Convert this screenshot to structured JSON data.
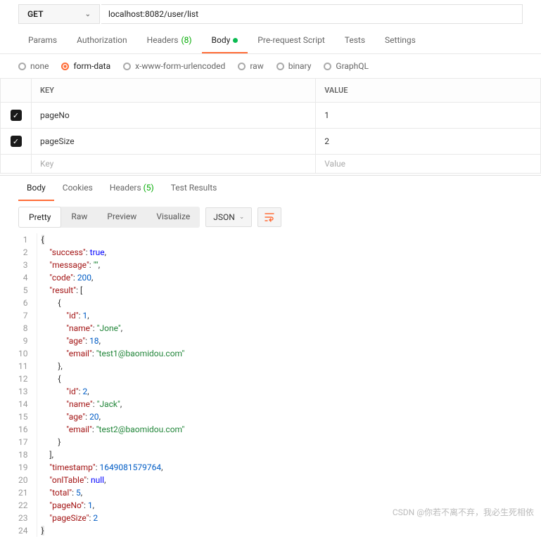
{
  "request": {
    "method": "GET",
    "url": "localhost:8082/user/list"
  },
  "tabs": {
    "params": "Params",
    "authorization": "Authorization",
    "headers": "Headers",
    "headers_count": "(8)",
    "body": "Body",
    "prerequest": "Pre-request Script",
    "tests": "Tests",
    "settings": "Settings"
  },
  "body_types": {
    "none": "none",
    "formdata": "form-data",
    "urlencoded": "x-www-form-urlencoded",
    "raw": "raw",
    "binary": "binary",
    "graphql": "GraphQL"
  },
  "params_table": {
    "headers": {
      "key": "KEY",
      "value": "VALUE"
    },
    "rows": [
      {
        "key": "pageNo",
        "value": "1"
      },
      {
        "key": "pageSize",
        "value": "2"
      }
    ],
    "placeholder": {
      "key": "Key",
      "value": "Value"
    }
  },
  "resp_tabs": {
    "body": "Body",
    "cookies": "Cookies",
    "headers": "Headers",
    "headers_count": "(5)",
    "test_results": "Test Results"
  },
  "view_tabs": {
    "pretty": "Pretty",
    "raw": "Raw",
    "preview": "Preview",
    "visualize": "Visualize"
  },
  "format": "JSON",
  "response_json": {
    "success": true,
    "message": "",
    "code": 200,
    "result": [
      {
        "id": 1,
        "name": "Jone",
        "age": 18,
        "email": "test1@baomidou.com"
      },
      {
        "id": 2,
        "name": "Jack",
        "age": 20,
        "email": "test2@baomidou.com"
      }
    ],
    "timestamp": 1649081579764,
    "onlTable": null,
    "total": 5,
    "pageNo": 1,
    "pageSize": 2
  },
  "watermark": "CSDN @你若不离不弃，我必生死相依"
}
